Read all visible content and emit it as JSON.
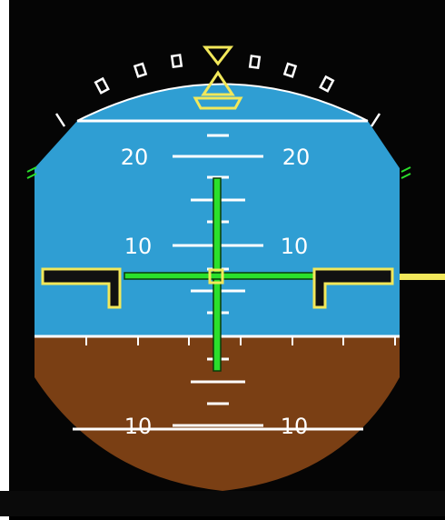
{
  "pfd": {
    "pitch_scale": {
      "upper_left": "20",
      "upper_right": "20",
      "mid_left": "10",
      "mid_right": "10",
      "lower_left": "10",
      "lower_right": "10"
    },
    "colors": {
      "sky": "#2f9ed3",
      "ground": "#7a3f14",
      "scale": "#ffffff",
      "flight_director": "#2be02b",
      "aircraft_symbol": "#f2e85a",
      "roll_pointer": "#f2e85a",
      "background": "#050505"
    },
    "icons": {
      "roll_pointer": "triangle-pointer-icon",
      "aircraft_symbol": "aircraft-reference-icon",
      "flight_director": "flight-director-cross-icon"
    }
  }
}
